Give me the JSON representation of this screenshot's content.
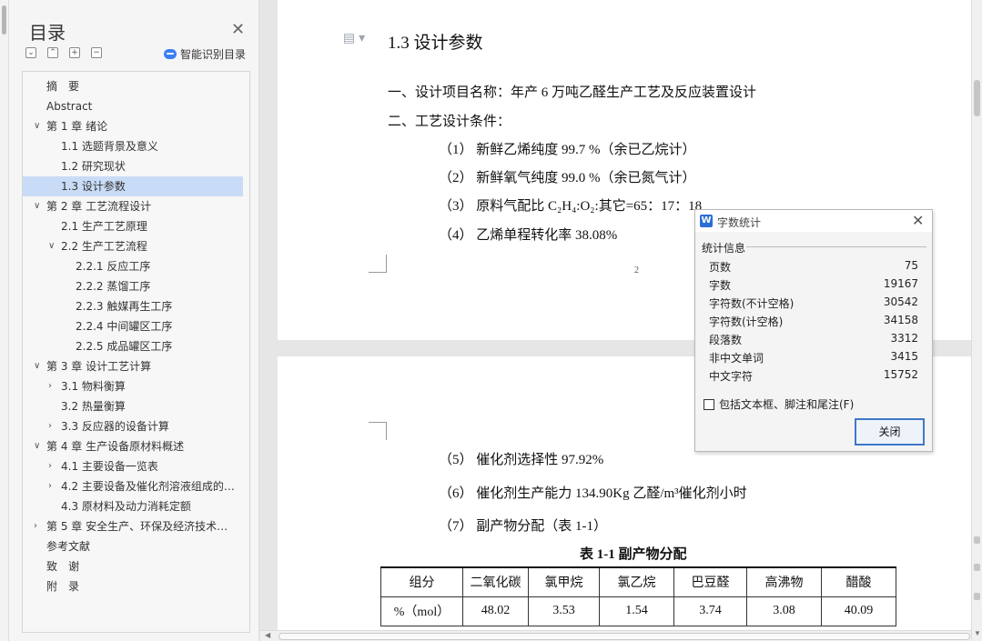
{
  "toc": {
    "title": "目录",
    "smart_toc_label": "智能识别目录",
    "items": [
      {
        "label": "摘　要",
        "level": 0,
        "arrow": ""
      },
      {
        "label": "Abstract",
        "level": 0,
        "arrow": ""
      },
      {
        "label": "第 1 章  绪论",
        "level": 0,
        "arrow": "∨"
      },
      {
        "label": "1.1 选题背景及意义",
        "level": 1,
        "arrow": ""
      },
      {
        "label": "1.2 研究现状",
        "level": 1,
        "arrow": ""
      },
      {
        "label": "1.3 设计参数",
        "level": 1,
        "arrow": "",
        "selected": true
      },
      {
        "label": "第 2 章  工艺流程设计",
        "level": 0,
        "arrow": "∨"
      },
      {
        "label": "2.1 生产工艺原理",
        "level": 1,
        "arrow": ""
      },
      {
        "label": "2.2 生产工艺流程",
        "level": 1,
        "arrow": "∨"
      },
      {
        "label": "2.2.1 反应工序",
        "level": 2,
        "arrow": ""
      },
      {
        "label": "2.2.2 蒸馏工序",
        "level": 2,
        "arrow": ""
      },
      {
        "label": "2.2.3 触媒再生工序",
        "level": 2,
        "arrow": ""
      },
      {
        "label": "2.2.4 中间罐区工序",
        "level": 2,
        "arrow": ""
      },
      {
        "label": "2.2.5 成品罐区工序",
        "level": 2,
        "arrow": ""
      },
      {
        "label": "第 3 章  设计工艺计算",
        "level": 0,
        "arrow": "∨"
      },
      {
        "label": "3.1 物料衡算",
        "level": 1,
        "arrow": "›"
      },
      {
        "label": "3.2 热量衡算",
        "level": 1,
        "arrow": ""
      },
      {
        "label": "3.3 反应器的设备计算",
        "level": 1,
        "arrow": "›"
      },
      {
        "label": "第 4 章  生产设备原材料概述",
        "level": 0,
        "arrow": "∨"
      },
      {
        "label": "4.1 主要设备一览表",
        "level": 1,
        "arrow": "›"
      },
      {
        "label": "4.2 主要设备及催化剂溶液组成的…",
        "level": 1,
        "arrow": "›"
      },
      {
        "label": "4.3 原材料及动力消耗定额",
        "level": 1,
        "arrow": ""
      },
      {
        "label": "第 5 章  安全生产、环保及经济技术…",
        "level": 0,
        "arrow": "›"
      },
      {
        "label": "参考文献",
        "level": 0,
        "arrow": ""
      },
      {
        "label": "致　谢",
        "level": 0,
        "arrow": ""
      },
      {
        "label": "附　录",
        "level": 0,
        "arrow": ""
      }
    ]
  },
  "document": {
    "page1": {
      "heading": "1.3 设计参数",
      "line1": "一、设计项目名称：年产 6 万吨乙醛生产工艺及反应装置设计",
      "line2": "二、工艺设计条件：",
      "item1": "（1）  新鲜乙烯纯度 99.7 %（余已乙烷计）",
      "item2": "（2）  新鲜氧气纯度 99.0 %（余已氮气计）",
      "item3": "（3）  原料气配比 C₂H₄:O₂:其它=65：17：18",
      "item4": "（4）  乙烯单程转化率    38.08%",
      "page_number": "2"
    },
    "page2": {
      "item5": "（5）  催化剂选择性    97.92%",
      "item6": "（6）  催化剂生产能力    134.90Kg 乙醛/m³催化剂小时",
      "item7": "（7）  副产物分配（表 1-1）",
      "table_caption": "表 1-1  副产物分配",
      "table": {
        "headers": [
          "组分",
          "二氧化碳",
          "氯甲烷",
          "氯乙烷",
          "巴豆醛",
          "高沸物",
          "醋酸"
        ],
        "row": [
          "%（mol）",
          "48.02",
          "3.53",
          "1.54",
          "3.74",
          "3.08",
          "40.09"
        ]
      }
    }
  },
  "dialog": {
    "title": "字数统计",
    "section": "统计信息",
    "stats": [
      {
        "label": "页数",
        "value": "75"
      },
      {
        "label": "字数",
        "value": "19167"
      },
      {
        "label": "字符数(不计空格)",
        "value": "30542"
      },
      {
        "label": "字符数(计空格)",
        "value": "34158"
      },
      {
        "label": "段落数",
        "value": "3312"
      },
      {
        "label": "非中文单词",
        "value": "3415"
      },
      {
        "label": "中文字符",
        "value": "15752"
      }
    ],
    "checkbox_label": "包括文本框、脚注和尾注(F)",
    "close_button": "关闭"
  }
}
